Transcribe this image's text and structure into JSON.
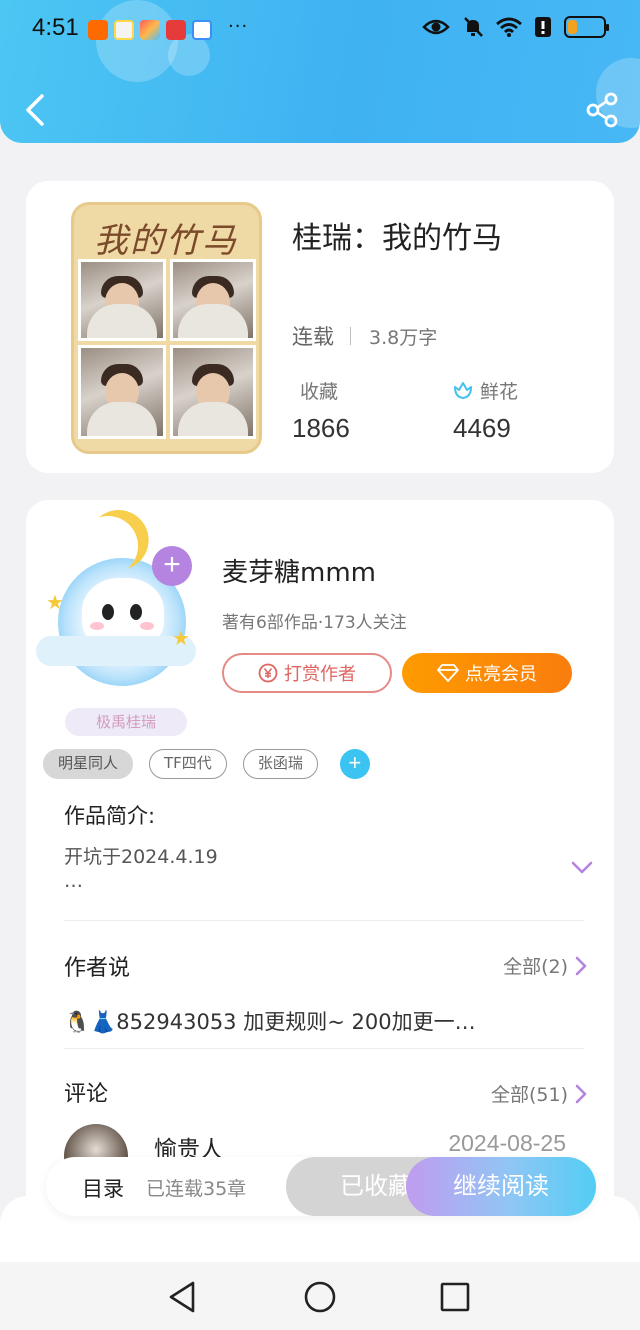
{
  "status_bar": {
    "time": "4:51",
    "apps": [
      {
        "name": "taobao-app-icon",
        "color": "#ff6a00"
      },
      {
        "name": "chat-app-icon",
        "color": "#ffd84a"
      },
      {
        "name": "tasks-app-icon",
        "color": "#ff5a5a"
      },
      {
        "name": "huawei-app-icon",
        "color": "#e63b3b"
      },
      {
        "name": "browser-app-icon",
        "color": "#3a8ef5"
      }
    ],
    "more": "···",
    "battery_level": 0.25
  },
  "book": {
    "title": "桂瑞：我的竹马",
    "cover_title": "我的竹马",
    "status": "连载",
    "word_count": "3.8万字",
    "favorites_label": "收藏",
    "favorites_count": "1866",
    "flowers_label": "鲜花",
    "flowers_count": "4469"
  },
  "author": {
    "name": "麦芽糖mmm",
    "meta": "著有6部作品·173人关注",
    "pendant_label": "极禹桂瑞",
    "reward_label": "打赏作者",
    "vip_label": "点亮会员"
  },
  "tags": [
    "明星同人",
    "TF四代",
    "张函瑞"
  ],
  "intro": {
    "label": "作品简介:",
    "text": "开坑于2024.4.19",
    "ellipsis": "…"
  },
  "author_says": {
    "title": "作者说",
    "more": "全部(2)",
    "note": "🐧👗852943053 加更规则~ 200加更一…"
  },
  "comments": {
    "title": "评论",
    "more": "全部(51)",
    "first_user": "愉贵人",
    "first_date": "2024-08-25"
  },
  "action_bar": {
    "toc_label": "目录",
    "chapter_count": "已连载35章",
    "collected_label": "已收藏",
    "read_label": "继续阅读"
  },
  "colors": {
    "header_blue": "#3fb2f2",
    "accent_purple": "#b583e0",
    "vip_orange": "#ff9b00",
    "reward_red": "#e06560"
  }
}
